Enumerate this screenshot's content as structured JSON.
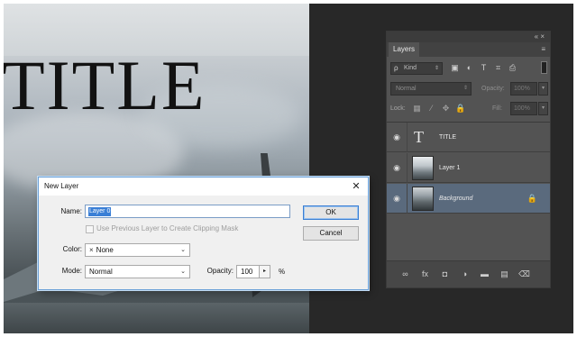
{
  "canvas": {
    "title_text": "TITLE"
  },
  "layers_panel": {
    "collapse_glyph": "«",
    "close_glyph": "×",
    "tab_label": "Layers",
    "menu_glyph": "≡",
    "filter": {
      "search_glyph": "ρ",
      "kind_label": "Kind",
      "arrows": "⇕"
    },
    "filter_icons": [
      "▣",
      "◐",
      "T",
      "⌗",
      "⎙"
    ],
    "blend_mode": "Normal",
    "opacity_label": "Opacity:",
    "opacity_value": "100%",
    "lock_label": "Lock:",
    "lock_icons": [
      "▦",
      "⁄",
      "✥",
      "🔒"
    ],
    "fill_label": "Fill:",
    "fill_value": "100%",
    "dropdown_arrow": "▾",
    "eye_glyph": "◉",
    "layers": [
      {
        "name": "TITLE",
        "type": "text",
        "thumb_glyph": "T"
      },
      {
        "name": "Layer 1",
        "type": "image"
      },
      {
        "name": "Background",
        "type": "image",
        "selected": true,
        "locked": true,
        "lock_glyph": "🔒"
      }
    ],
    "footer_icons": [
      "∞",
      "fx",
      "◘",
      "◑",
      "▬",
      "▤",
      "⌫"
    ]
  },
  "dialog": {
    "title": "New Layer",
    "close_glyph": "✕",
    "name_label": "Name:",
    "name_value": "Layer 0",
    "clip_label": "Use Previous Layer to Create Clipping Mask",
    "clip_checked": false,
    "color_label": "Color:",
    "color_prefix": "×",
    "color_value": "None",
    "mode_label": "Mode:",
    "mode_value": "Normal",
    "opacity_label": "Opacity:",
    "opacity_value": "100",
    "opacity_unit": "%",
    "select_arrow": "⌄",
    "stepper_glyph": "▸",
    "ok_label": "OK",
    "cancel_label": "Cancel"
  }
}
